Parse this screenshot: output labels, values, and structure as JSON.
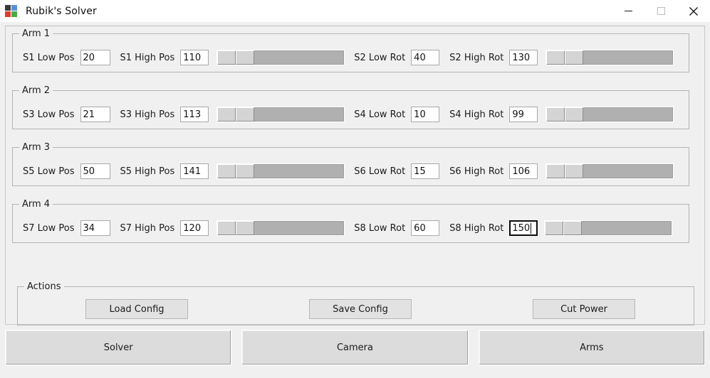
{
  "window": {
    "title": "Rubik's Solver",
    "icon": "rubiks-cube-icon",
    "controls": {
      "minimize": "minimize-icon",
      "maximize": "maximize-icon",
      "close": "close-icon"
    }
  },
  "groups": [
    {
      "legend": "Arm 1",
      "fields": [
        {
          "label": "S1 Low Pos",
          "value": "20",
          "focused": false
        },
        {
          "label": "S1 High Pos",
          "value": "110",
          "focused": false
        },
        {
          "label": "S2 Low Rot",
          "value": "40",
          "focused": false
        },
        {
          "label": "S2 High Rot",
          "value": "130",
          "focused": false
        }
      ],
      "sliders": [
        {
          "low": 0,
          "high": 14,
          "name": "arm1-position-range-slider"
        },
        {
          "low": 0,
          "high": 14,
          "name": "arm1-rotation-range-slider"
        }
      ]
    },
    {
      "legend": "Arm 2",
      "fields": [
        {
          "label": "S3 Low Pos",
          "value": "21",
          "focused": false
        },
        {
          "label": "S3 High Pos",
          "value": "113",
          "focused": false
        },
        {
          "label": "S4 Low Rot",
          "value": "10",
          "focused": false
        },
        {
          "label": "S4 High Rot",
          "value": "99",
          "focused": false
        }
      ],
      "sliders": [
        {
          "low": 0,
          "high": 14,
          "name": "arm2-position-range-slider"
        },
        {
          "low": 0,
          "high": 14,
          "name": "arm2-rotation-range-slider"
        }
      ]
    },
    {
      "legend": "Arm 3",
      "fields": [
        {
          "label": "S5 Low Pos",
          "value": "50",
          "focused": false
        },
        {
          "label": "S5 High Pos",
          "value": "141",
          "focused": false
        },
        {
          "label": "S6 Low Rot",
          "value": "15",
          "focused": false
        },
        {
          "label": "S6 High Rot",
          "value": "106",
          "focused": false
        }
      ],
      "sliders": [
        {
          "low": 0,
          "high": 14,
          "name": "arm3-position-range-slider"
        },
        {
          "low": 0,
          "high": 14,
          "name": "arm3-rotation-range-slider"
        }
      ]
    },
    {
      "legend": "Arm 4",
      "fields": [
        {
          "label": "S7 Low Pos",
          "value": "34",
          "focused": false
        },
        {
          "label": "S7 High Pos",
          "value": "120",
          "focused": false
        },
        {
          "label": "S8 Low Rot",
          "value": "60",
          "focused": false
        },
        {
          "label": "S8 High Rot",
          "value": "150",
          "focused": true
        }
      ],
      "sliders": [
        {
          "low": 0,
          "high": 14,
          "name": "arm4-position-range-slider"
        },
        {
          "low": 0,
          "high": 14,
          "name": "arm4-rotation-range-slider"
        }
      ]
    }
  ],
  "actions": {
    "legend": "Actions",
    "buttons": [
      {
        "label": "Load Config"
      },
      {
        "label": "Save Config"
      },
      {
        "label": "Cut Power"
      }
    ]
  },
  "nav": {
    "tabs": [
      {
        "label": "Solver"
      },
      {
        "label": "Camera"
      },
      {
        "label": "Arms"
      }
    ]
  },
  "colors": {
    "window_bg": "#f0f0f0",
    "titlebar_bg": "#ffffff",
    "entry_bg": "#ffffff",
    "button_bg": "#dcdcdc",
    "slider_track": "#b0b0b0",
    "slider_handle": "#d4d4d4",
    "group_border": "#b4b4b4",
    "text": "#1b1b1b"
  }
}
